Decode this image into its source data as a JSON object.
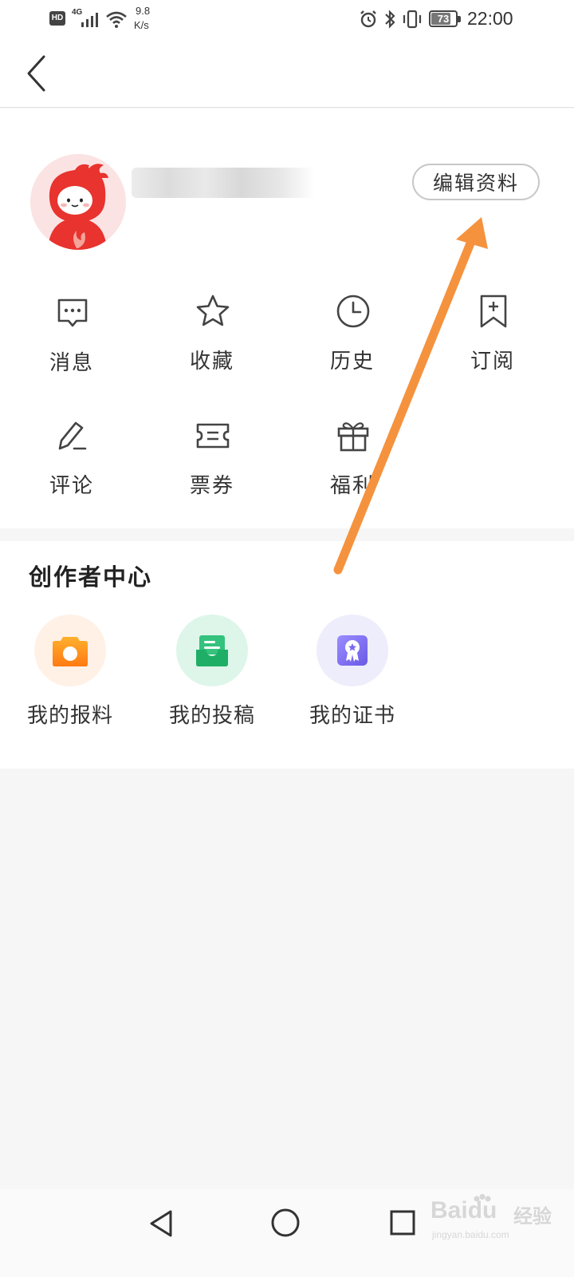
{
  "status_bar": {
    "network_speed": "9.8",
    "network_speed_unit": "K/s",
    "battery_level": "73",
    "time": "22:00",
    "network_type": "4G",
    "hd_badge": "HD"
  },
  "profile": {
    "edit_profile_label": "编辑资料"
  },
  "grid": {
    "items": [
      {
        "label": "消息",
        "icon": "message-icon"
      },
      {
        "label": "收藏",
        "icon": "star-icon"
      },
      {
        "label": "历史",
        "icon": "clock-icon"
      },
      {
        "label": "订阅",
        "icon": "bookmark-icon"
      },
      {
        "label": "评论",
        "icon": "pen-icon"
      },
      {
        "label": "票券",
        "icon": "ticket-icon"
      },
      {
        "label": "福利",
        "icon": "gift-icon"
      }
    ]
  },
  "creator_center": {
    "title": "创作者中心",
    "items": [
      {
        "label": "我的报料",
        "icon": "camera-icon",
        "color": "#ff8a1c"
      },
      {
        "label": "我的投稿",
        "icon": "inbox-icon",
        "color": "#1fbf6e"
      },
      {
        "label": "我的证书",
        "icon": "certificate-icon",
        "color": "#7a6cf0"
      }
    ]
  },
  "watermark": {
    "brand": "Bai",
    "brand_mid": "du",
    "brand_cn": "经验",
    "url": "jingyan.baidu.com"
  },
  "colors": {
    "arrow": "#f5923e",
    "mascot_red": "#e8332e",
    "panel_bg": "#ffffff",
    "page_bg": "#f6f6f6"
  }
}
